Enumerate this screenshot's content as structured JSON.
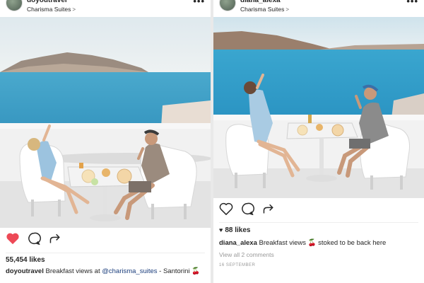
{
  "posts": [
    {
      "username": "doyoutravel",
      "location": "Charisma Suites",
      "liked": true,
      "likes_text": "55,454 likes",
      "caption_user": "doyoutravel",
      "caption_before": "Breakfast views at",
      "caption_mention": "@charisma_suites",
      "caption_after": "- Santorini",
      "caption_emoji": "🍒"
    },
    {
      "username": "diana_alexa",
      "location": "Charisma Suites",
      "liked": false,
      "likes_text": "88 likes",
      "caption_user": "diana_alexa",
      "caption_before": "Breakfast views",
      "caption_emoji": "🍒",
      "caption_after": "stoked to be back here",
      "view_comments": "View all 2 comments",
      "date": "16 SEPTEMBER"
    }
  ],
  "icons": {
    "like": "heart-icon",
    "comment": "comment-icon",
    "share": "share-icon",
    "more": "more-options-icon",
    "chevron": "chevron-right-icon"
  },
  "colors": {
    "like_red": "#ed4956",
    "sea": "#3aa0c4",
    "sky": "#e9f0f3",
    "mention": "#1a3d7c"
  }
}
